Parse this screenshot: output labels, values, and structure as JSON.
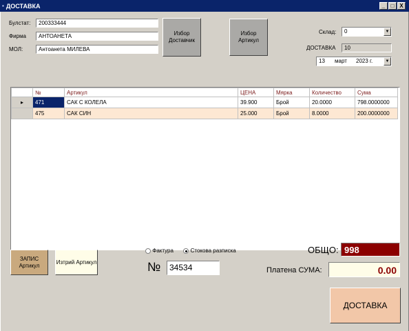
{
  "window": {
    "title": "ДОСТАВКА",
    "controls": [
      "_",
      "□",
      "X"
    ]
  },
  "supplier": {
    "bulstat_label": "Булстат:",
    "bulstat_value": "200333444",
    "firm_label": "Фирма",
    "firm_value": "АНТОАНЕТА",
    "mol_label": "МОЛ:",
    "mol_value": "Антоанета МИЛЕВА"
  },
  "buttons": {
    "choose_supplier": "Избор Доставчик",
    "choose_article": "Избор Артикул",
    "save_article": "ЗАПИС Артикул",
    "delete_article": "Изтрий Артикул",
    "delivery": "ДОСТАВКА"
  },
  "right_panel": {
    "warehouse_label": "Склад:",
    "warehouse_value": "0",
    "delivery_label": "ДОСТАВКА",
    "delivery_number": "10",
    "date_day": "13",
    "date_month": "март",
    "date_year": "2023 г."
  },
  "table": {
    "columns": [
      "№",
      "Артикул",
      "ЦЕНА",
      "Мярка",
      "Количество",
      "Сума"
    ],
    "rows": [
      [
        "471",
        "САК С КОЛЕЛА",
        "39.900",
        "Брой",
        "20.0000",
        "798.0000000"
      ],
      [
        "475",
        "САК СИН",
        "25.000",
        "Брой",
        "8.0000",
        "200.0000000"
      ]
    ],
    "current_row_marker": "▸"
  },
  "doc_type": {
    "option_invoice": "Фактура",
    "option_receipt": "Стокова разписка",
    "selected": "Стокова разписка"
  },
  "number": {
    "label": "№",
    "value": "34534"
  },
  "totals": {
    "total_label": "ОБЩО:",
    "total_value": "998",
    "paid_label": "Платена СУМА:",
    "paid_value": "0.00"
  },
  "colors": {
    "title_bar": "#0a246a",
    "total_bg": "#8b0000",
    "paid_text": "#8b0000",
    "row_alt": "#fde8d3",
    "save_btn": "#c9a97e",
    "delivery_btn": "#f2c7a8"
  }
}
